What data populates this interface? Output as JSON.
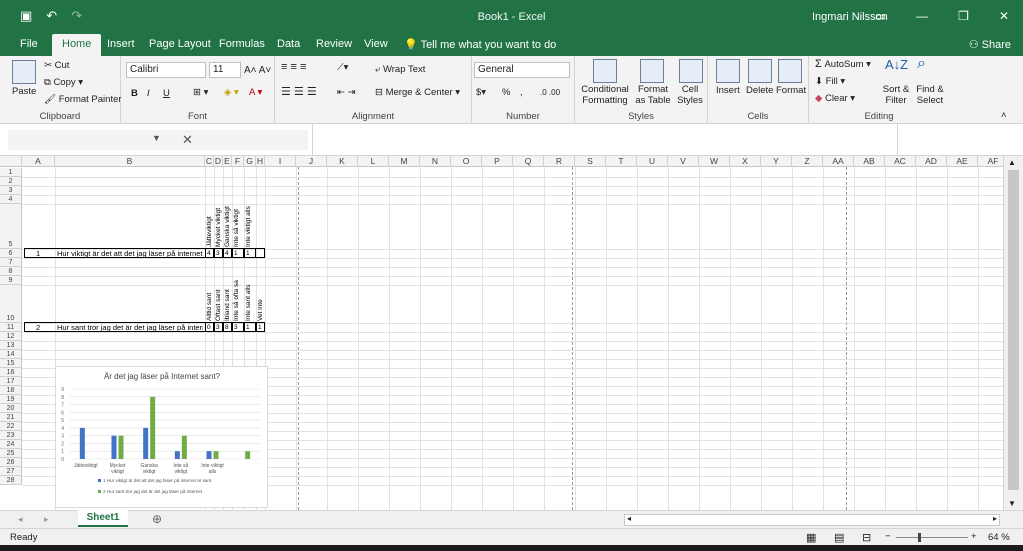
{
  "app": {
    "title": "Book1  -  Excel",
    "user": "Ingmari Nilsson",
    "share": "Share"
  },
  "tabs": [
    "File",
    "Home",
    "Insert",
    "Page Layout",
    "Formulas",
    "Data",
    "Review",
    "View"
  ],
  "tell_me": "Tell me what you want to do",
  "ribbon": {
    "clipboard": {
      "label": "Clipboard",
      "paste": "Paste",
      "cut": "Cut",
      "copy": "Copy",
      "format_painter": "Format Painter"
    },
    "font": {
      "label": "Font",
      "name": "Calibri",
      "size": "11",
      "bold": "B",
      "italic": "I",
      "underline": "U"
    },
    "alignment": {
      "label": "Alignment",
      "wrap": "Wrap Text",
      "merge": "Merge & Center"
    },
    "number": {
      "label": "Number",
      "format": "General",
      "percent": "%",
      "comma": ","
    },
    "styles": {
      "label": "Styles",
      "cond": "Conditional Formatting",
      "table": "Format as Table",
      "cell": "Cell Styles"
    },
    "cells": {
      "label": "Cells",
      "insert": "Insert",
      "delete": "Delete",
      "format": "Format"
    },
    "editing": {
      "label": "Editing",
      "autosum": "AutoSum",
      "fill": "Fill",
      "clear": "Clear",
      "sort": "Sort & Filter",
      "find": "Find & Select"
    }
  },
  "columns": [
    "A",
    "B",
    "C",
    "D",
    "E",
    "F",
    "G",
    "H",
    "I",
    "J",
    "K",
    "L",
    "M",
    "N",
    "O",
    "P",
    "Q",
    "R",
    "S",
    "T",
    "U",
    "V",
    "W",
    "X",
    "Y",
    "Z",
    "AA",
    "AB",
    "AC",
    "AD",
    "AE",
    "AF"
  ],
  "rows": [
    "1",
    "2",
    "3",
    "4",
    "5",
    "6",
    "7",
    "8",
    "9",
    "10",
    "11",
    "12",
    "13",
    "14",
    "15",
    "16",
    "17",
    "18",
    "19",
    "20",
    "21",
    "22",
    "23",
    "24",
    "25",
    "26",
    "27",
    "28"
  ],
  "sheet": {
    "q1_headers": [
      "Jätteviktigt",
      "Mycket viktigt",
      "Ganska viktigt",
      "Inte så viktigt",
      "Inte viktigt alls"
    ],
    "q1_num": "1",
    "q1_text": "Hur viktigt är det att det jag läser på internet är sant?",
    "q1_values": [
      "4",
      "3",
      "4",
      "1",
      "1"
    ],
    "q2_headers": [
      "Alltid sant",
      "Oftast sant",
      "Ibland sant",
      "Inte så ofta sa",
      "Inte sant alls",
      "Vet inte"
    ],
    "q2_num": "2",
    "q2_text": "Hur sant tror jag det är det jag läser på internet",
    "q2_values": [
      "0",
      "3",
      "8",
      "3",
      "1",
      "1"
    ]
  },
  "chart_data": {
    "type": "bar",
    "title": "Är det jag läser på Internet sant?",
    "categories": [
      "Jätteviktigt",
      "Mycket viktigt",
      "Ganska viktigt",
      "Inte så viktigt",
      "Inte viktigt alls",
      ""
    ],
    "series": [
      {
        "name": "1 Hur viktigt är det att det jag läser på internet är sant",
        "color": "#4472c4",
        "values": [
          4,
          3,
          4,
          1,
          1,
          0
        ]
      },
      {
        "name": "2 Hur sant tror jag det är det jag läser på internet",
        "color": "#70ad47",
        "values": [
          0,
          3,
          8,
          3,
          1,
          1
        ]
      }
    ],
    "ylim": [
      0,
      9
    ],
    "yticks": [
      "0",
      "1",
      "2",
      "3",
      "4",
      "5",
      "6",
      "7",
      "8",
      "9"
    ],
    "legend": "bottom"
  },
  "sheet_tab": "Sheet1",
  "status": {
    "ready": "Ready",
    "zoom": "64 %"
  }
}
